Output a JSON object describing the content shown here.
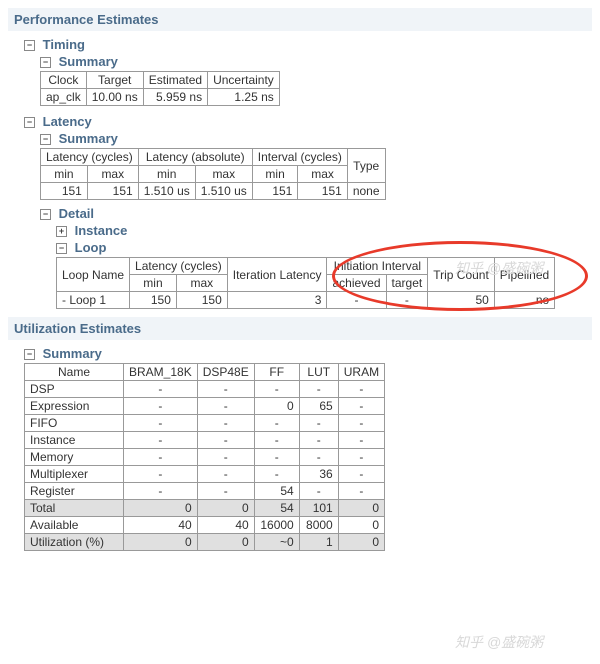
{
  "perf_title": "Performance Estimates",
  "timing": {
    "title": "Timing",
    "summary_title": "Summary",
    "headers": [
      "Clock",
      "Target",
      "Estimated",
      "Uncertainty"
    ],
    "row": {
      "clock": "ap_clk",
      "target": "10.00 ns",
      "estimated": "5.959 ns",
      "uncertainty": "1.25 ns"
    }
  },
  "latency": {
    "title": "Latency",
    "summary_title": "Summary",
    "group_headers": [
      "Latency (cycles)",
      "Latency (absolute)",
      "Interval (cycles)"
    ],
    "sub_headers": [
      "min",
      "max",
      "min",
      "max",
      "min",
      "max",
      "Type"
    ],
    "row": [
      "151",
      "151",
      "1.510 us",
      "1.510 us",
      "151",
      "151",
      "none"
    ],
    "detail_title": "Detail",
    "instance_title": "Instance",
    "loop_title": "Loop",
    "loop_group_headers": {
      "latency": "Latency (cycles)",
      "init": "Initiation Interval"
    },
    "loop_headers": [
      "Loop Name",
      "min",
      "max",
      "Iteration Latency",
      "achieved",
      "target",
      "Trip Count",
      "Pipelined"
    ],
    "loop_row": {
      "name": "- Loop 1",
      "min": "150",
      "max": "150",
      "iter": "3",
      "achieved": "-",
      "target": "-",
      "trip": "50",
      "pipelined": "no"
    }
  },
  "util": {
    "title": "Utilization Estimates",
    "summary_title": "Summary",
    "headers": [
      "Name",
      "BRAM_18K",
      "DSP48E",
      "FF",
      "LUT",
      "URAM"
    ],
    "rows": [
      {
        "name": "DSP",
        "vals": [
          "-",
          "-",
          "-",
          "-",
          "-"
        ]
      },
      {
        "name": "Expression",
        "vals": [
          "-",
          "-",
          "0",
          "65",
          "-"
        ]
      },
      {
        "name": "FIFO",
        "vals": [
          "-",
          "-",
          "-",
          "-",
          "-"
        ]
      },
      {
        "name": "Instance",
        "vals": [
          "-",
          "-",
          "-",
          "-",
          "-"
        ]
      },
      {
        "name": "Memory",
        "vals": [
          "-",
          "-",
          "-",
          "-",
          "-"
        ]
      },
      {
        "name": "Multiplexer",
        "vals": [
          "-",
          "-",
          "-",
          "36",
          "-"
        ]
      },
      {
        "name": "Register",
        "vals": [
          "-",
          "-",
          "54",
          "-",
          "-"
        ]
      }
    ],
    "total": {
      "name": "Total",
      "vals": [
        "0",
        "0",
        "54",
        "101",
        "0"
      ]
    },
    "available": {
      "name": "Available",
      "vals": [
        "40",
        "40",
        "16000",
        "8000",
        "0"
      ]
    },
    "utilization": {
      "name": "Utilization (%)",
      "vals": [
        "0",
        "0",
        "~0",
        "1",
        "0"
      ]
    }
  },
  "watermark": "知乎 @盛碗粥",
  "chart_data": {
    "type": "table",
    "tables": [
      {
        "title": "Timing Summary",
        "columns": [
          "Clock",
          "Target",
          "Estimated",
          "Uncertainty"
        ],
        "rows": [
          [
            "ap_clk",
            "10.00 ns",
            "5.959 ns",
            "1.25 ns"
          ]
        ]
      },
      {
        "title": "Latency Summary",
        "columns": [
          "Latency(cycles) min",
          "Latency(cycles) max",
          "Latency(absolute) min",
          "Latency(absolute) max",
          "Interval(cycles) min",
          "Interval(cycles) max",
          "Type"
        ],
        "rows": [
          [
            151,
            151,
            "1.510 us",
            "1.510 us",
            151,
            151,
            "none"
          ]
        ]
      },
      {
        "title": "Loop Detail",
        "columns": [
          "Loop Name",
          "Latency min",
          "Latency max",
          "Iteration Latency",
          "Initiation achieved",
          "Initiation target",
          "Trip Count",
          "Pipelined"
        ],
        "rows": [
          [
            "- Loop 1",
            150,
            150,
            3,
            "-",
            "-",
            50,
            "no"
          ]
        ]
      },
      {
        "title": "Utilization Summary",
        "columns": [
          "Name",
          "BRAM_18K",
          "DSP48E",
          "FF",
          "LUT",
          "URAM"
        ],
        "rows": [
          [
            "DSP",
            "-",
            "-",
            "-",
            "-",
            "-"
          ],
          [
            "Expression",
            "-",
            "-",
            0,
            65,
            "-"
          ],
          [
            "FIFO",
            "-",
            "-",
            "-",
            "-",
            "-"
          ],
          [
            "Instance",
            "-",
            "-",
            "-",
            "-",
            "-"
          ],
          [
            "Memory",
            "-",
            "-",
            "-",
            "-",
            "-"
          ],
          [
            "Multiplexer",
            "-",
            "-",
            "-",
            36,
            "-"
          ],
          [
            "Register",
            "-",
            "-",
            54,
            "-",
            "-"
          ],
          [
            "Total",
            0,
            0,
            54,
            101,
            0
          ],
          [
            "Available",
            40,
            40,
            16000,
            8000,
            0
          ],
          [
            "Utilization (%)",
            0,
            0,
            "~0",
            1,
            0
          ]
        ]
      }
    ]
  }
}
